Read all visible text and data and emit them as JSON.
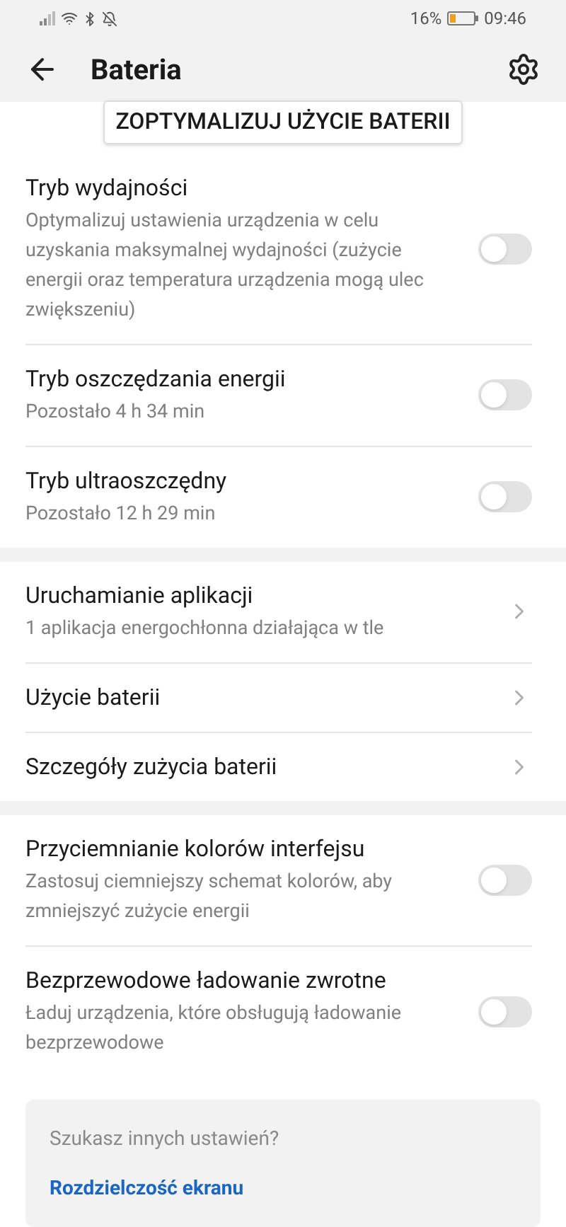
{
  "status_bar": {
    "battery_percent": "16%",
    "time": "09:46"
  },
  "app_bar": {
    "title": "Bateria"
  },
  "optimize_button": "ZOPTYMALIZUJ UŻYCIE BATERII",
  "sections": [
    {
      "items": [
        {
          "kind": "toggle",
          "title": "Tryb wydajności",
          "subtitle": "Optymalizuj ustawienia urządzenia w celu uzyskania maksymalnej wydajności (zużycie energii oraz temperatura urządzenia mogą ulec zwiększeniu)",
          "on": false
        },
        {
          "kind": "toggle",
          "title": "Tryb oszczędzania energii",
          "subtitle": "Pozostało 4 h 34 min",
          "on": false
        },
        {
          "kind": "toggle",
          "title": "Tryb ultraoszczędny",
          "subtitle": "Pozostało 12 h 29 min",
          "on": false
        }
      ]
    },
    {
      "items": [
        {
          "kind": "link",
          "title": "Uruchamianie aplikacji",
          "subtitle": "1 aplikacja energochłonna działająca w tle"
        },
        {
          "kind": "link",
          "title": "Użycie baterii"
        },
        {
          "kind": "link",
          "title": "Szczegóły zużycia baterii"
        }
      ]
    },
    {
      "items": [
        {
          "kind": "toggle",
          "title": "Przyciemnianie kolorów interfejsu",
          "subtitle": "Zastosuj ciemniejszy schemat kolorów, aby zmniejszyć zużycie energii",
          "on": false
        },
        {
          "kind": "toggle",
          "title": "Bezprzewodowe ładowanie zwrotne",
          "subtitle": "Ładuj urządzenia, które obsługują ładowanie bezprzewodowe",
          "on": false
        }
      ]
    }
  ],
  "suggestion": {
    "question": "Szukasz innych ustawień?",
    "link": "Rozdzielczość ekranu"
  }
}
